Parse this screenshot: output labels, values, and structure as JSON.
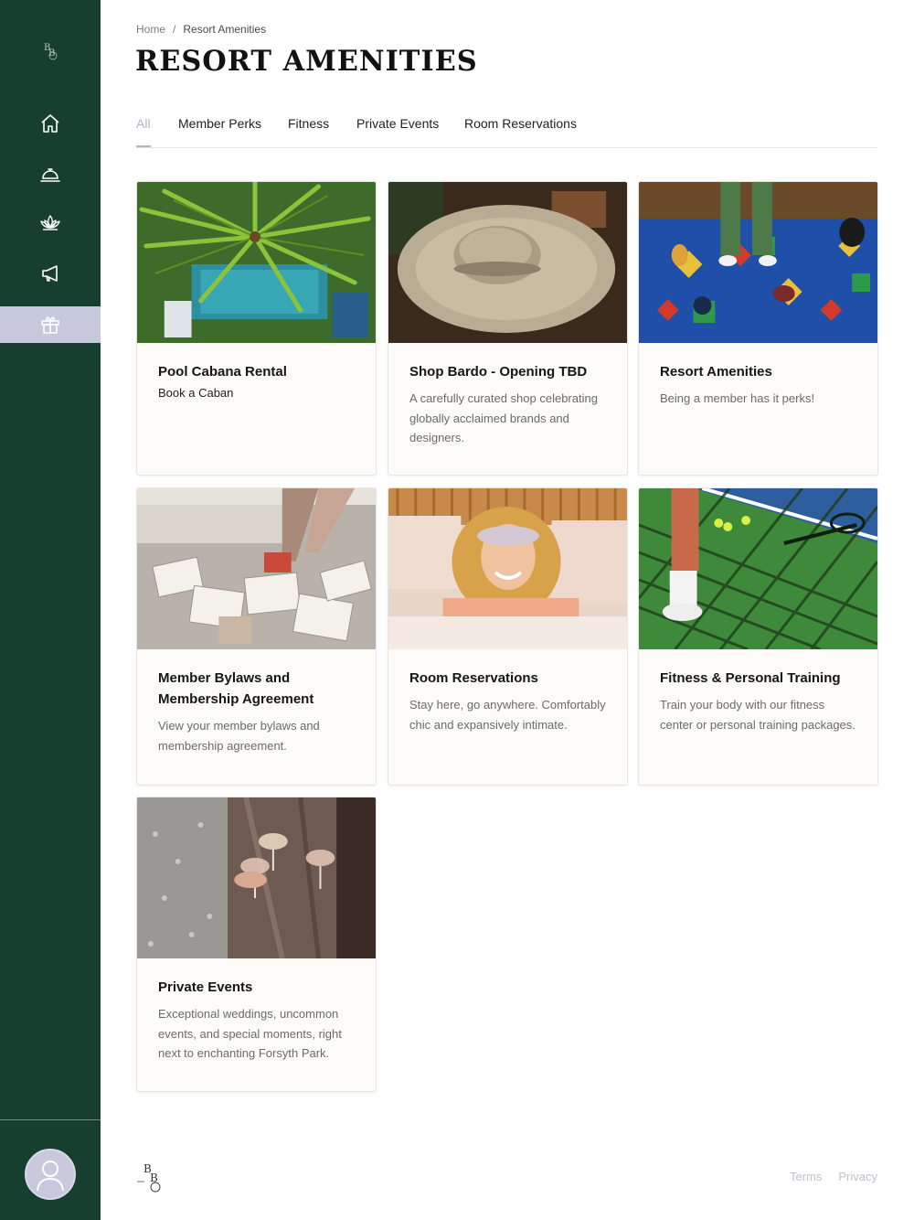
{
  "sidebar": {
    "logo_text": "BB",
    "items": [
      {
        "icon": "home-icon"
      },
      {
        "icon": "service-bell-icon"
      },
      {
        "icon": "lotus-icon"
      },
      {
        "icon": "megaphone-icon"
      },
      {
        "icon": "gift-icon",
        "active": true
      }
    ]
  },
  "breadcrumb": {
    "home": "Home",
    "separator": "/",
    "current": "Resort Amenities"
  },
  "page": {
    "title": "RESORT AMENITIES"
  },
  "tabs": [
    {
      "label": "All",
      "active": true
    },
    {
      "label": "Member Perks"
    },
    {
      "label": "Fitness"
    },
    {
      "label": "Private Events"
    },
    {
      "label": "Room Reservations"
    }
  ],
  "cards": [
    {
      "title": "Pool Cabana Rental",
      "subtitle": "Book a Caban",
      "description": ""
    },
    {
      "title": "Shop Bardo - Opening TBD",
      "subtitle": "",
      "description": "A carefully curated shop celebrating globally acclaimed brands and designers."
    },
    {
      "title": "Resort Amenities",
      "subtitle": "",
      "description": "Being a member has it perks!"
    },
    {
      "title": "Member Bylaws and Membership Agreement",
      "subtitle": "",
      "description": "View your member bylaws and membership agreement."
    },
    {
      "title": "Room Reservations",
      "subtitle": "",
      "description": "Stay here, go anywhere. Comfortably chic and expansively intimate."
    },
    {
      "title": "Fitness & Personal Training",
      "subtitle": "",
      "description": "Train your body with our fitness center or personal training packages."
    },
    {
      "title": "Private Events",
      "subtitle": "",
      "description": "Exceptional weddings, uncommon events, and special moments, right next to enchanting Forsyth Park."
    }
  ],
  "footer": {
    "terms": "Terms",
    "privacy": "Privacy"
  },
  "colors": {
    "sidebar_bg": "#163f2f",
    "active_nav": "#c7c8dc",
    "card_bg": "#fcfbf7",
    "muted_link": "#bfc0d2"
  }
}
